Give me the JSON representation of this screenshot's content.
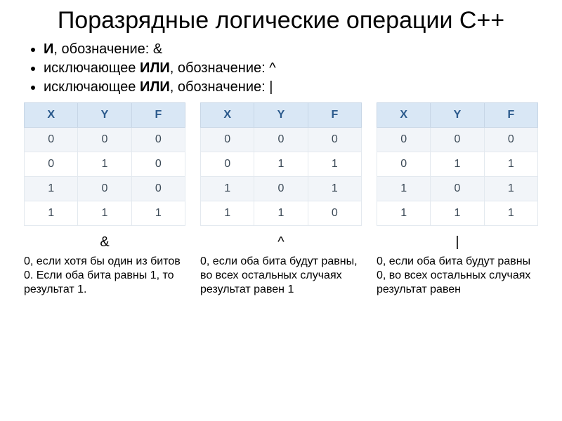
{
  "title": "Поразрядные логические операции C++",
  "bullets": [
    {
      "name": "И",
      "rest": ", обозначение: &"
    },
    {
      "name": "ИЛИ",
      "prefix": "исключающее ",
      "rest": ", обозначение:  ^"
    },
    {
      "name": "ИЛИ",
      "prefix": "исключающее ",
      "rest": ", обозначение:  |"
    }
  ],
  "tables": {
    "headers": [
      "X",
      "Y",
      "F"
    ],
    "and": {
      "symbol": "&",
      "rows": [
        [
          "0",
          "0",
          "0"
        ],
        [
          "0",
          "1",
          "0"
        ],
        [
          "1",
          "0",
          "0"
        ],
        [
          "1",
          "1",
          "1"
        ]
      ]
    },
    "xor": {
      "symbol": "^",
      "rows": [
        [
          "0",
          "0",
          "0"
        ],
        [
          "0",
          "1",
          "1"
        ],
        [
          "1",
          "0",
          "1"
        ],
        [
          "1",
          "1",
          "0"
        ]
      ]
    },
    "or": {
      "symbol": "|",
      "rows": [
        [
          "0",
          "0",
          "0"
        ],
        [
          "0",
          "1",
          "1"
        ],
        [
          "1",
          "0",
          "1"
        ],
        [
          "1",
          "1",
          "1"
        ]
      ]
    }
  },
  "descriptions": {
    "and": "0, если хотя бы один из битов 0. Если оба бита равны 1, то результат 1.",
    "xor": "0, если оба бита будут равны, во всех остальных случаях результат равен 1",
    "or": "0, если оба бита будут равны 0, во всех остальных случаях результат равен"
  }
}
